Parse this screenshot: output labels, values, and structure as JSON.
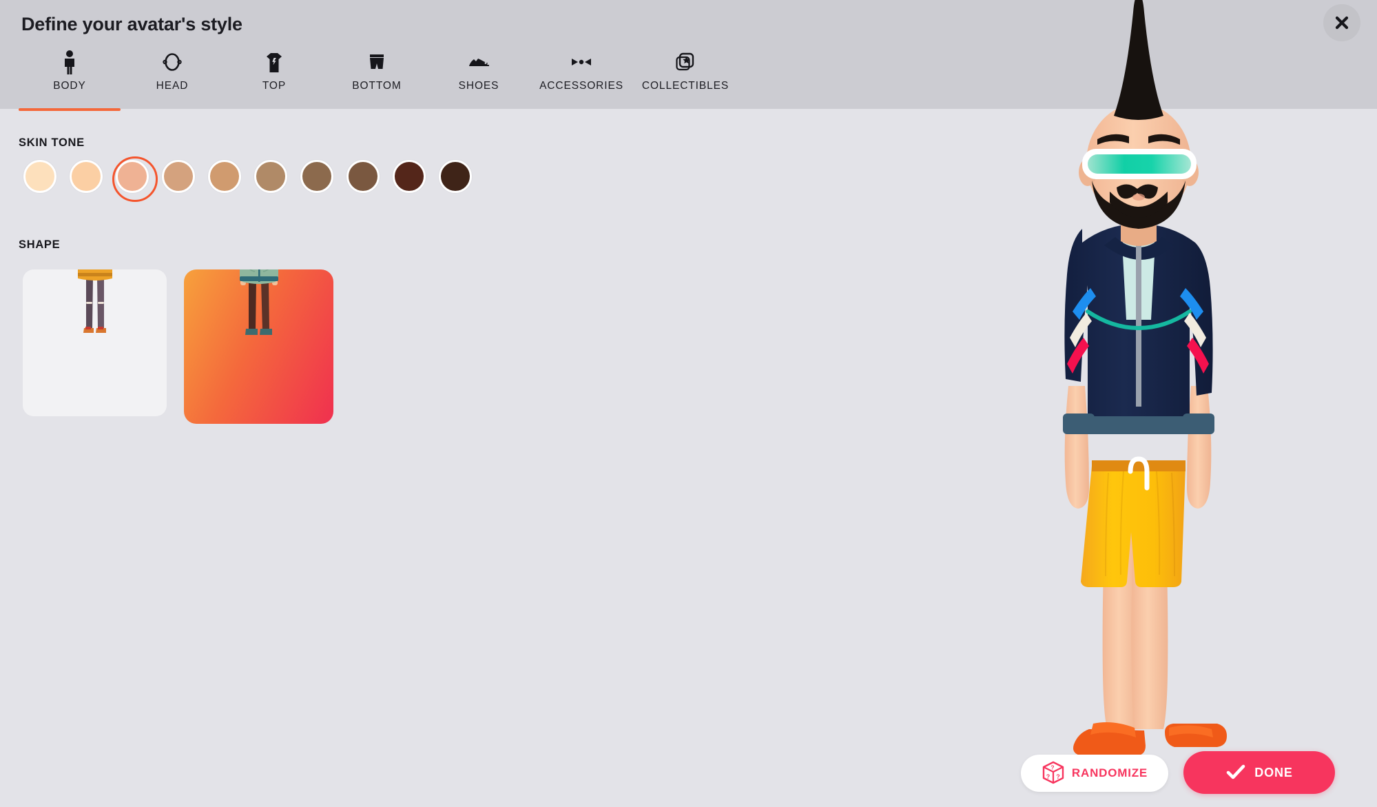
{
  "header": {
    "title": "Define your avatar's style",
    "close_icon": "close-icon"
  },
  "tabs": [
    {
      "id": "body",
      "label": "BODY",
      "icon": "person-icon",
      "active": true
    },
    {
      "id": "head",
      "label": "HEAD",
      "icon": "head-icon",
      "active": false
    },
    {
      "id": "top",
      "label": "TOP",
      "icon": "tshirt-icon",
      "active": false
    },
    {
      "id": "bottom",
      "label": "BOTTOM",
      "icon": "shorts-icon",
      "active": false
    },
    {
      "id": "shoes",
      "label": "SHOES",
      "icon": "sneaker-icon",
      "active": false
    },
    {
      "id": "accessories",
      "label": "ACCESSORIES",
      "icon": "bowtie-icon",
      "active": false
    },
    {
      "id": "collectibles",
      "label": "COLLECTIBLES",
      "icon": "star-cards-icon",
      "active": false
    }
  ],
  "skin_tone": {
    "label": "SKIN TONE",
    "selected_index": 2,
    "selection_ring_color": "#f4552d",
    "swatches": [
      {
        "name": "skin-tone-1",
        "color": "#fde0bc"
      },
      {
        "name": "skin-tone-2",
        "color": "#fbcfa4"
      },
      {
        "name": "skin-tone-3",
        "color": "#efb294"
      },
      {
        "name": "skin-tone-4",
        "color": "#d4a27e"
      },
      {
        "name": "skin-tone-5",
        "color": "#d09b6f"
      },
      {
        "name": "skin-tone-6",
        "color": "#b08a67"
      },
      {
        "name": "skin-tone-7",
        "color": "#8c6a4d"
      },
      {
        "name": "skin-tone-8",
        "color": "#7a5840"
      },
      {
        "name": "skin-tone-9",
        "color": "#54261a"
      },
      {
        "name": "skin-tone-10",
        "color": "#3f2418"
      }
    ]
  },
  "shape": {
    "label": "SHAPE",
    "selected_index": 1,
    "selected_border_gradient": [
      "#f7a13c",
      "#f4693c",
      "#f0304f"
    ],
    "options": [
      {
        "name": "shape-option-feminine",
        "selected": false
      },
      {
        "name": "shape-option-masculine",
        "selected": true
      }
    ]
  },
  "actions": {
    "randomize_label": "RANDOMIZE",
    "randomize_icon": "dice-question-icon",
    "randomize_color": "#f7355e",
    "done_label": "DONE",
    "done_icon": "check-icon",
    "done_color": "#f7355e"
  },
  "avatar_preview": {
    "name": "avatar-preview",
    "hair": "black-mohawk",
    "glasses": "teal-visor",
    "facial_hair": "black-beard-mustache",
    "top": "navy-track-jacket",
    "inner_top": "mint-tshirt",
    "bottom": "yellow-shorts",
    "shoes": "orange-slides",
    "skin": "#f6c9a4"
  }
}
